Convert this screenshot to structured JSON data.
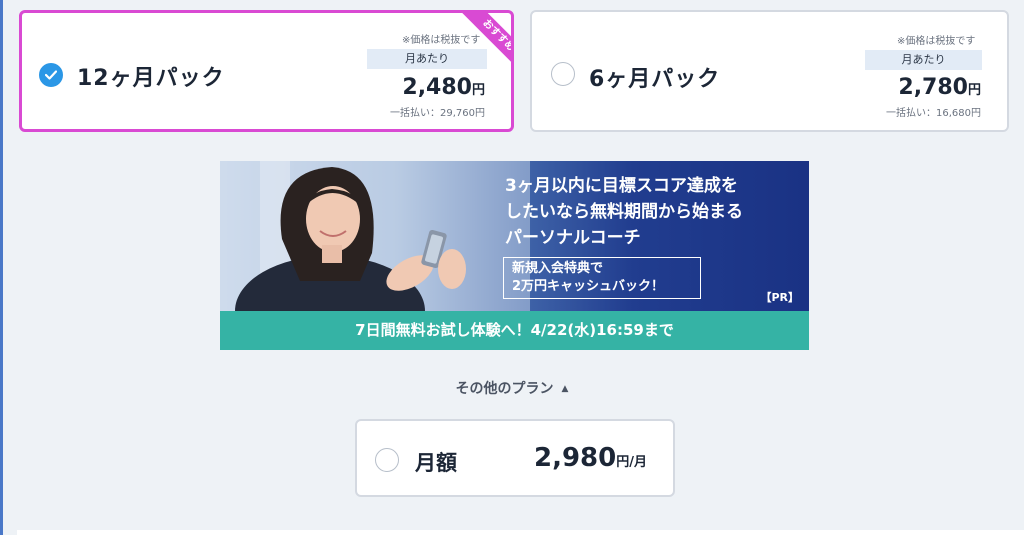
{
  "plans": {
    "twelve": {
      "name": "12ヶ月パック",
      "tax_note": "※価格は税抜です",
      "per_month_label": "月あたり",
      "price": "2,480",
      "price_unit": "円",
      "lump_sum": "一括払い：29,760円",
      "ribbon": "おすすめ",
      "selected": true
    },
    "six": {
      "name": "6ヶ月パック",
      "tax_note": "※価格は税抜です",
      "per_month_label": "月あたり",
      "price": "2,780",
      "price_unit": "円",
      "lump_sum": "一括払い：16,680円",
      "selected": false
    }
  },
  "banner": {
    "headline": "3ヶ月以内に目標スコア達成を\nしたいなら無料期間から始まる\nパーソナルコーチ",
    "promo_box": "新規入会特典で\n2万円キャッシュバック！",
    "pr_label": "【PR】",
    "cta": "7日間無料お試し体験へ！4/22(水)16:59まで"
  },
  "other_plans": {
    "toggle_label": "その他のプラン",
    "toggle_icon": "caret-up-icon",
    "monthly": {
      "name": "月額",
      "price": "2,980",
      "price_unit": "円/月",
      "selected": false
    }
  },
  "colors": {
    "accent_pink": "#d94ad3",
    "check_blue": "#2b97e6",
    "banner_teal": "#35b3a5",
    "banner_navy": "#1a3284"
  }
}
